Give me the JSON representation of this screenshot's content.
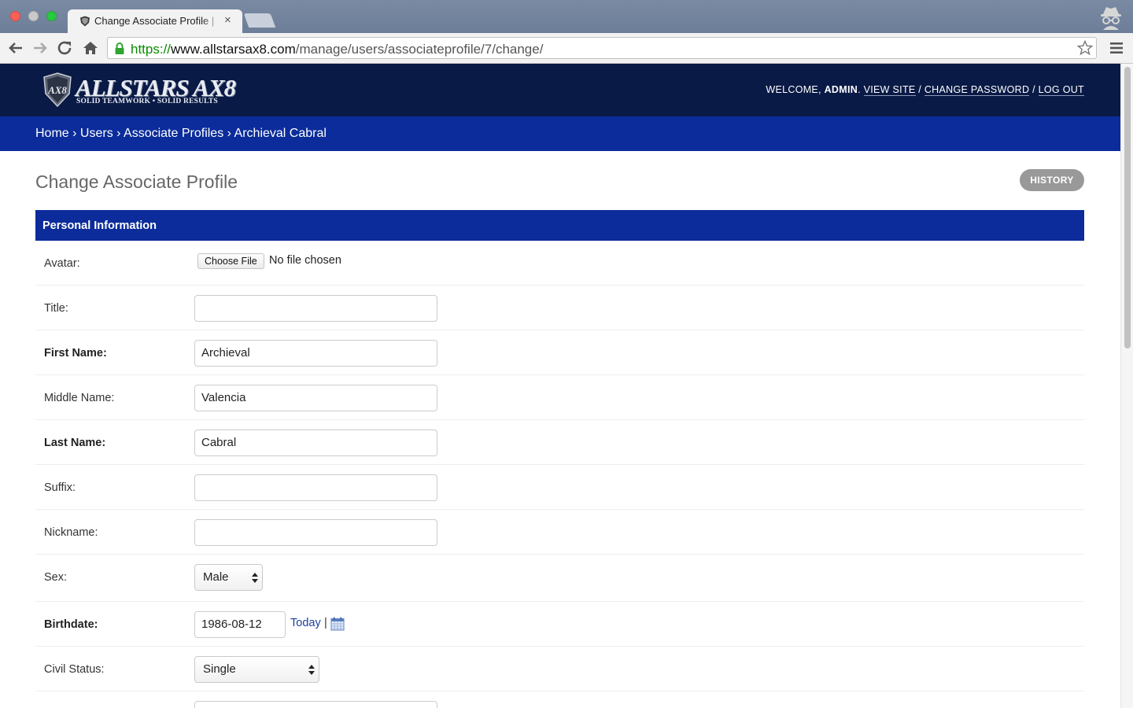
{
  "browser": {
    "tab_title": "Change Associate Profile | ",
    "close_glyph": "×",
    "url_scheme": "https://",
    "url_host": "www.allstarsax8.com",
    "url_path": "/manage/users/associateprofile/7/change/"
  },
  "header": {
    "logo_name": "ALLSTARS AX8",
    "logo_tagline": "SOLID TEAMWORK • SOLID RESULTS",
    "welcome_prefix": "WELCOME, ",
    "username": "ADMIN",
    "welcome_suffix": ". ",
    "view_site": "VIEW SITE",
    "sep": " / ",
    "change_password": "CHANGE PASSWORD",
    "log_out": "LOG OUT"
  },
  "breadcrumbs": {
    "home": "Home",
    "users": "Users",
    "associate_profiles": "Associate Profiles",
    "current": "Archieval Cabral",
    "sep": " › "
  },
  "page": {
    "title": "Change Associate Profile",
    "history_button": "HISTORY"
  },
  "fieldset": {
    "title": "Personal Information",
    "avatar": {
      "label": "Avatar:",
      "button": "Choose File",
      "status": "No file chosen"
    },
    "title_field": {
      "label": "Title:",
      "value": ""
    },
    "first_name": {
      "label": "First Name:",
      "value": "Archieval"
    },
    "middle_name": {
      "label": "Middle Name:",
      "value": "Valencia"
    },
    "last_name": {
      "label": "Last Name:",
      "value": "Cabral"
    },
    "suffix": {
      "label": "Suffix:",
      "value": ""
    },
    "nickname": {
      "label": "Nickname:",
      "value": ""
    },
    "sex": {
      "label": "Sex:",
      "value": "Male"
    },
    "birthdate": {
      "label": "Birthdate:",
      "value": "1986-08-12",
      "today_link": "Today",
      "separator": "|"
    },
    "civil_status": {
      "label": "Civil Status:",
      "value": "Single"
    }
  },
  "colors": {
    "header_bg": "#0a1a46",
    "breadcrumb_bg": "#0b2c9a",
    "fieldset_head_bg": "#0b2c9a",
    "history_bg": "#999999",
    "link_blue": "#1d3f9e"
  },
  "icons": {
    "favicon": "shield-icon",
    "lock": "lock-icon",
    "star": "star-icon",
    "menu": "hamburger-menu-icon",
    "calendar": "calendar-icon",
    "profile": "incognito-icon"
  }
}
